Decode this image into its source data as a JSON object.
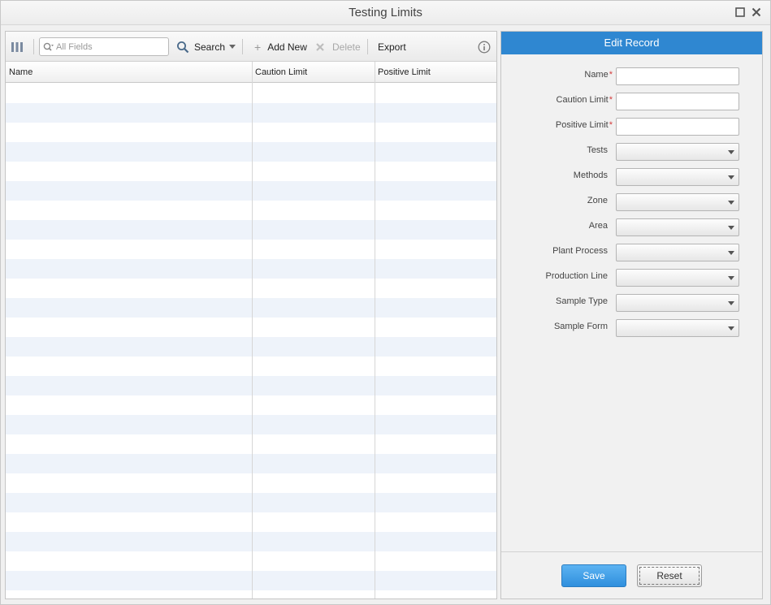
{
  "window": {
    "title": "Testing Limits",
    "maximize_icon": "square-icon",
    "close_icon": "close-icon"
  },
  "toolbar": {
    "columns_icon": "columns-icon",
    "search_placeholder": "All Fields",
    "search_label": "Search",
    "add_new_label": "Add New",
    "delete_label": "Delete",
    "export_label": "Export",
    "info_icon": "info-icon"
  },
  "grid": {
    "columns": [
      "Name",
      "Caution Limit",
      "Positive Limit"
    ],
    "row_count": 26,
    "alt_row_color": "#eef3fa"
  },
  "edit_record": {
    "title": "Edit Record",
    "accent_color": "#2f87d1",
    "fields": [
      {
        "label": "Name",
        "required": true,
        "type": "text",
        "value": ""
      },
      {
        "label": "Caution Limit",
        "required": true,
        "type": "text",
        "value": ""
      },
      {
        "label": "Positive Limit",
        "required": true,
        "type": "text",
        "value": ""
      },
      {
        "label": "Tests",
        "required": false,
        "type": "combo",
        "value": ""
      },
      {
        "label": "Methods",
        "required": false,
        "type": "combo",
        "value": ""
      },
      {
        "label": "Zone",
        "required": false,
        "type": "combo",
        "value": ""
      },
      {
        "label": "Area",
        "required": false,
        "type": "combo",
        "value": ""
      },
      {
        "label": "Plant Process",
        "required": false,
        "type": "combo",
        "value": ""
      },
      {
        "label": "Production Line",
        "required": false,
        "type": "combo",
        "value": ""
      },
      {
        "label": "Sample Type",
        "required": false,
        "type": "combo",
        "value": ""
      },
      {
        "label": "Sample Form",
        "required": false,
        "type": "combo",
        "value": ""
      }
    ],
    "save_label": "Save",
    "reset_label": "Reset",
    "required_marker": "*"
  }
}
